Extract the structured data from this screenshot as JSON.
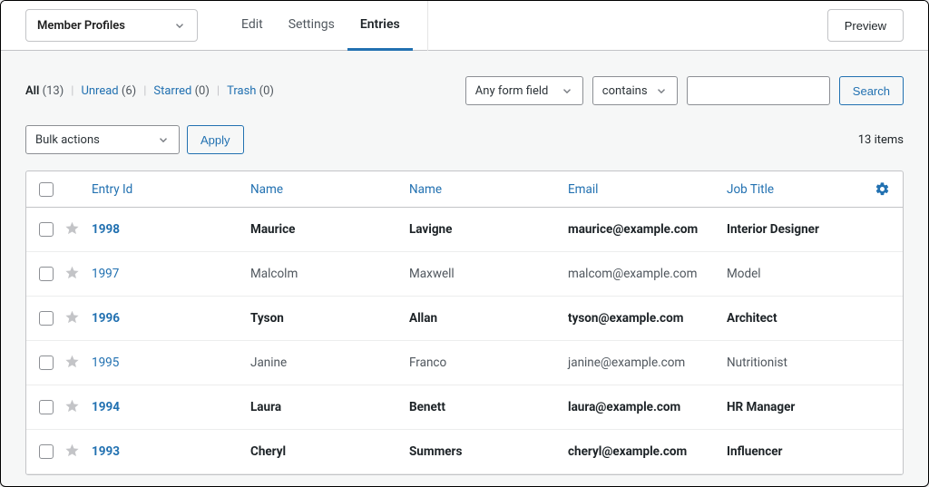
{
  "header": {
    "form_name": "Member Profiles",
    "tabs": [
      {
        "label": "Edit",
        "active": false
      },
      {
        "label": "Settings",
        "active": false
      },
      {
        "label": "Entries",
        "active": true
      }
    ],
    "preview_label": "Preview"
  },
  "status_filters": {
    "all_label": "All",
    "all_count": "(13)",
    "unread_label": "Unread",
    "unread_count": "(6)",
    "starred_label": "Starred",
    "starred_count": "(0)",
    "trash_label": "Trash",
    "trash_count": "(0)"
  },
  "search": {
    "field_label": "Any form field",
    "operator_label": "contains",
    "value": "",
    "button_label": "Search"
  },
  "bulk": {
    "select_label": "Bulk actions",
    "apply_label": "Apply"
  },
  "count_text": "13 items",
  "table": {
    "columns": {
      "entry_id": "Entry Id",
      "first_name": "Name",
      "last_name": "Name",
      "email": "Email",
      "job_title": "Job Title"
    },
    "rows": [
      {
        "id": "1998",
        "fn": "Maurice",
        "ln": "Lavigne",
        "em": "maurice@example.com",
        "jt": "Interior Designer",
        "unread": true
      },
      {
        "id": "1997",
        "fn": "Malcolm",
        "ln": "Maxwell",
        "em": "malcom@example.com",
        "jt": "Model",
        "unread": false
      },
      {
        "id": "1996",
        "fn": "Tyson",
        "ln": "Allan",
        "em": "tyson@example.com",
        "jt": "Architect",
        "unread": true
      },
      {
        "id": "1995",
        "fn": "Janine",
        "ln": "Franco",
        "em": "janine@example.com",
        "jt": "Nutritionist",
        "unread": false
      },
      {
        "id": "1994",
        "fn": "Laura",
        "ln": "Benett",
        "em": "laura@example.com",
        "jt": "HR Manager",
        "unread": true
      },
      {
        "id": "1993",
        "fn": "Cheryl",
        "ln": "Summers",
        "em": "cheryl@example.com",
        "jt": "Influencer",
        "unread": true
      }
    ]
  }
}
